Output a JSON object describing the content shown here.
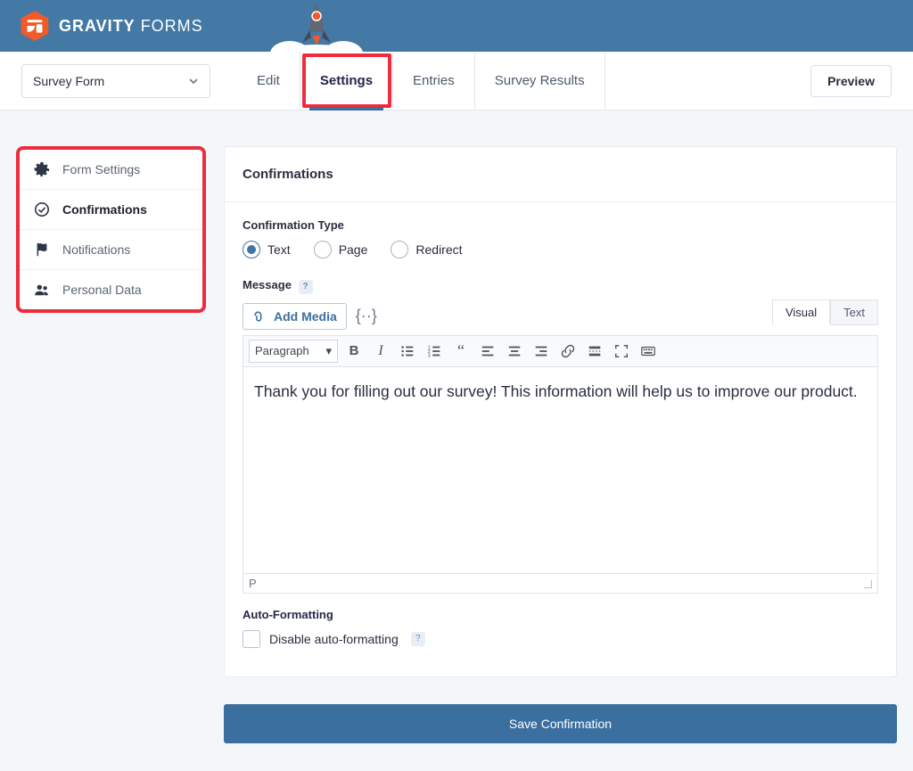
{
  "brand": {
    "name_bold": "GRAVITY",
    "name_rest": "FORMS"
  },
  "form_select": {
    "label": "Survey Form"
  },
  "tabs": {
    "edit": "Edit",
    "settings": "Settings",
    "entries": "Entries",
    "survey_results": "Survey Results"
  },
  "preview_label": "Preview",
  "sidebar": {
    "items": [
      {
        "label": "Form Settings"
      },
      {
        "label": "Confirmations"
      },
      {
        "label": "Notifications"
      },
      {
        "label": "Personal Data"
      }
    ]
  },
  "panel": {
    "title": "Confirmations",
    "confirmation_type_label": "Confirmation Type",
    "radios": {
      "text": "Text",
      "page": "Page",
      "redirect": "Redirect"
    },
    "message_label": "Message",
    "add_media_label": "Add Media",
    "mode_tabs": {
      "visual": "Visual",
      "text": "Text"
    },
    "paragraph_label": "Paragraph",
    "editor_text": "Thank you for filling out our survey! This information will help us to improve our product.",
    "status_path": "P",
    "auto_formatting_label": "Auto-Formatting",
    "disable_auto_label": "Disable auto-formatting",
    "save_label": "Save Confirmation"
  },
  "icons": {
    "gear": "gear-icon",
    "check_circle": "check-circle-icon",
    "flag": "flag-icon",
    "people": "people-icon"
  }
}
